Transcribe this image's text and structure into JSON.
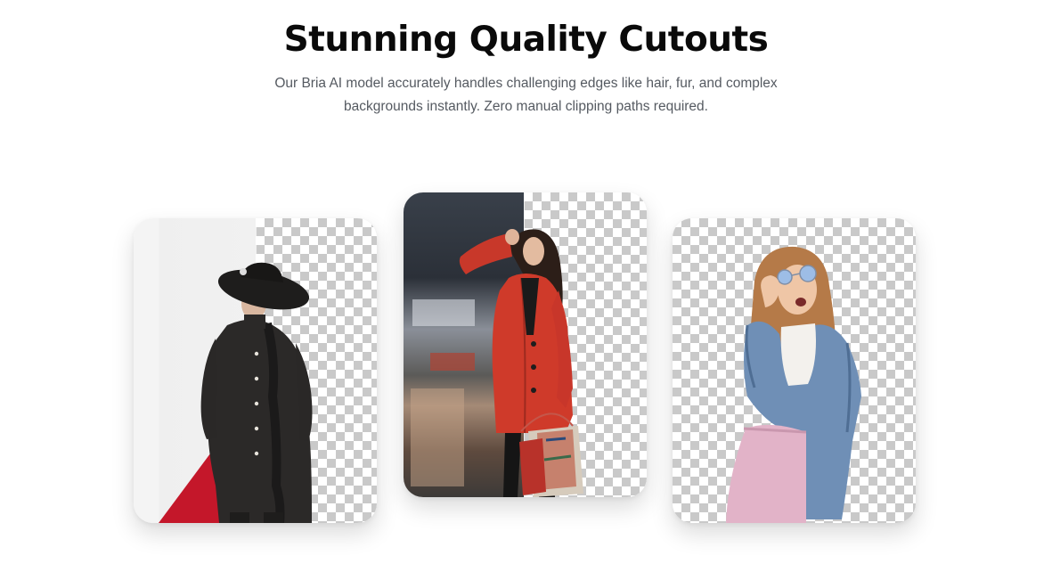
{
  "section": {
    "title": "Stunning Quality Cutouts",
    "subtitle": "Our Bria AI model accurately handles challenging edges like hair, fur, and complex backgrounds instantly. Zero manual clipping paths required."
  },
  "cards": [
    {
      "subject": "woman in black hat and black coat",
      "background": "white wall with red diagonal"
    },
    {
      "subject": "woman in red coat holding shopping bags",
      "background": "blurred street storefronts"
    },
    {
      "subject": "woman in sunglasses and denim jacket",
      "background": "transparent"
    }
  ],
  "colors": {
    "title": "#0a0a0a",
    "subtitle": "#555a61",
    "checker_dark": "#c9c9c9",
    "checker_light": "#ffffff"
  }
}
